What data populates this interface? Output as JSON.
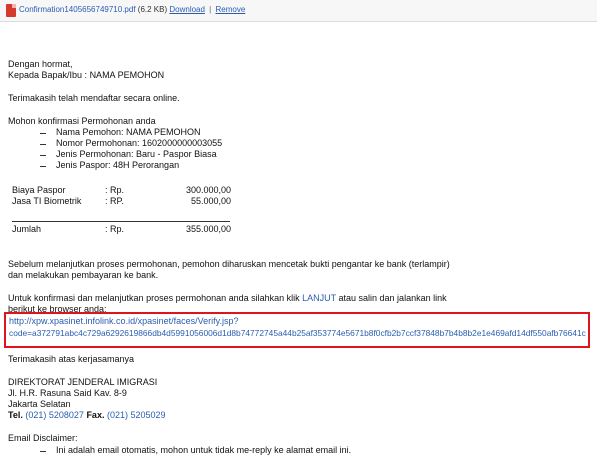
{
  "attachment": {
    "filename": "Confirmation1405656749710.pdf",
    "size": "(6.2 KB)",
    "download_label": "Download",
    "separator": "|",
    "remove_label": "Remove"
  },
  "email": {
    "greeting": "Dengan hormat,",
    "recipient": "Kepada Bapak/Ibu : NAMA PEMOHON",
    "thanks_online": "Terimakasih telah mendaftar secara online.",
    "confirm_intro": "Mohon konfirmasi Permohonan anda",
    "details": [
      "Nama Pemohon: NAMA PEMOHON",
      "Nomor Permohonan: 1602000000003055",
      "Jenis Permohonan: Baru - Paspor Biasa",
      "Jenis Paspor: 48H Perorangan"
    ],
    "fees": [
      {
        "label": "Biaya Paspor",
        "currency": ": Rp.",
        "amount": "300.000,00"
      },
      {
        "label": "Jasa TI Biometrik",
        "currency": ": RP.",
        "amount": "55.000,00"
      }
    ],
    "total": {
      "label": "Jumlah",
      "currency": ": Rp.",
      "amount": "355.000,00"
    },
    "para1_line1": "Sebelum melanjutkan proses permohonan, pemohon diharuskan mencetak bukti pengantar ke bank (terlampir)",
    "para1_line2": "dan melakukan pembayaran ke bank.",
    "para2_line1_pre": "Untuk konfirmasi dan melanjutkan proses permohonan anda silahkan klik ",
    "para2_link": "LANJUT",
    "para2_line1_post": " atau salin dan jalankan link",
    "para2_line2": "berikut ke browser anda:",
    "url_line1": "http://xpw.xpasinet.infolink.co.id/xpasinet/faces/Verify.jsp?",
    "url_line2": "code=a372791abc4c729a6292619866db4d5991056006d1d8b74772745a44b25af353774e5671b8f0cfb2b7ccf37848b7b4b8b2e1e469afd14df550afb76641c",
    "thanks_cooperation": "Terimakasih atas kerjasamanya",
    "signature": {
      "org": "DIREKTORAT JENDERAL IMIGRASI",
      "address": "Jl. H.R. Rasuna Said Kav. 8-9",
      "city": "Jakarta Selatan",
      "tel_label": "Tel.",
      "tel_number": "(021) 5208027",
      "fax_label": "Fax.",
      "fax_number": "(021) 5205029"
    },
    "disclaimer_title": "Email Disclaimer:",
    "disclaimer_item": "Ini adalah email otomatis, mohon untuk tidak me-reply ke alamat email ini."
  },
  "colors": {
    "link": "#2a5db0",
    "highlight_border": "#e0141c",
    "pdf_icon": "#d63a2c"
  },
  "icons": {
    "attachment": "pdf-file-icon"
  }
}
